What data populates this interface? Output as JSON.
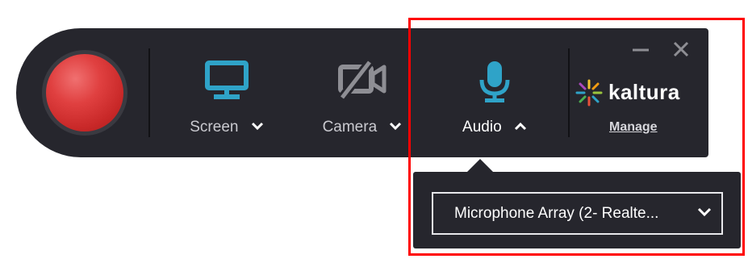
{
  "toolbar": {
    "record_button": "record",
    "screen": {
      "label": "Screen",
      "icon": "monitor-icon",
      "color": "#2fa3c8"
    },
    "camera": {
      "label": "Camera",
      "icon": "camera-off-icon",
      "color": "#8e8e94"
    },
    "audio": {
      "label": "Audio",
      "icon": "microphone-icon",
      "color": "#2fa3c8",
      "expanded": true
    },
    "brand": {
      "name": "kaltura"
    },
    "manage_label": "Manage"
  },
  "audio_panel": {
    "selected_device": "Microphone Array (2- Realte..."
  },
  "colors": {
    "toolbar_bg": "#26262d",
    "accent": "#2fa3c8",
    "record": "#e04040",
    "highlight": "#ff0000"
  }
}
